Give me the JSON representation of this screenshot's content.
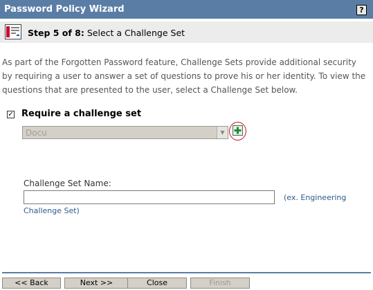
{
  "window": {
    "title": "Password Policy Wizard",
    "help_label": "?"
  },
  "step": {
    "number_label": "Step 5 of 8:",
    "title": "Select a Challenge Set",
    "icon": "wizard-step-icon"
  },
  "description": "As part of the Forgotten Password feature, Challenge Sets provide additional security by requiring a user to answer a set of questions to prove his or her identity. To view the questions that are presented to the user, select a Challenge Set below.",
  "require_challenge": {
    "checked": true,
    "check_glyph": "✓",
    "label": "Require a challenge set"
  },
  "challenge_select": {
    "value": "Docu",
    "disabled": true,
    "arrow_glyph": "▼"
  },
  "add_button": {
    "icon": "add-icon"
  },
  "challenge_name": {
    "label": "Challenge Set Name:",
    "value": "",
    "hint_line1": "(ex. Engineering",
    "hint_line2": "Challenge Set)"
  },
  "buttons": {
    "back": "<< Back",
    "next": "Next >>",
    "close": "Close",
    "finish": "Finish"
  },
  "colors": {
    "titlebar": "#5a7da6",
    "step_bg": "#ececec",
    "highlight": "#c8102e",
    "add_icon": "#1f8a3a"
  }
}
